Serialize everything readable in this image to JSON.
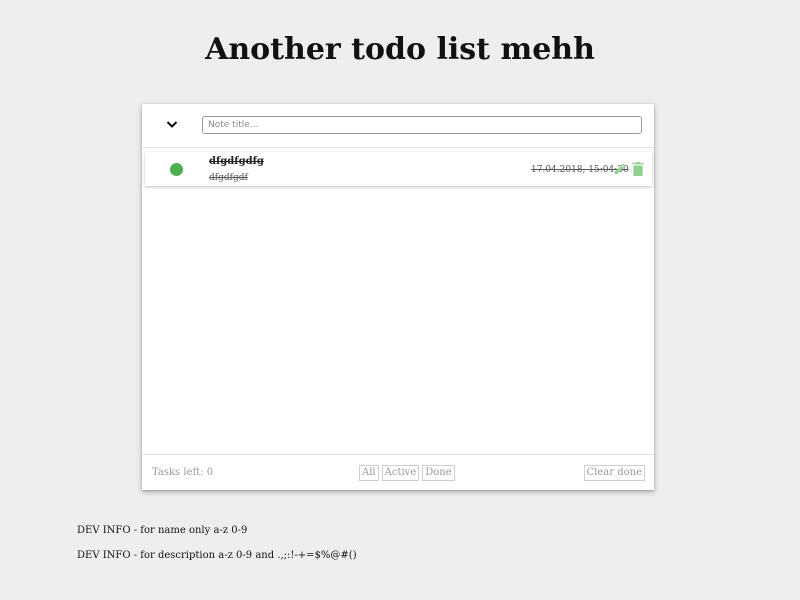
{
  "page": {
    "title": "Another todo list mehh"
  },
  "header": {
    "toggle_icon": "chevron-down-icon",
    "input_placeholder": "Note title...",
    "input_value": ""
  },
  "tasks": [
    {
      "name": "dfgdfgdfg",
      "description": "dfgdfgdf",
      "date": "17.04.2018, 15:04:30",
      "done": true,
      "status_color": "#4caf50",
      "edit_icon": "pencil-icon",
      "delete_icon": "trash-icon",
      "icon_color": "#8fd18f"
    }
  ],
  "footer": {
    "tasks_left": "Tasks left: 0",
    "filters": [
      "All",
      "Active",
      "Done"
    ],
    "clear_label": "Clear done"
  },
  "dev_info": [
    "DEV INFO - for name only a-z 0-9",
    "DEV INFO - for description a-z 0-9 and .,;:!-+=$%@#()"
  ]
}
